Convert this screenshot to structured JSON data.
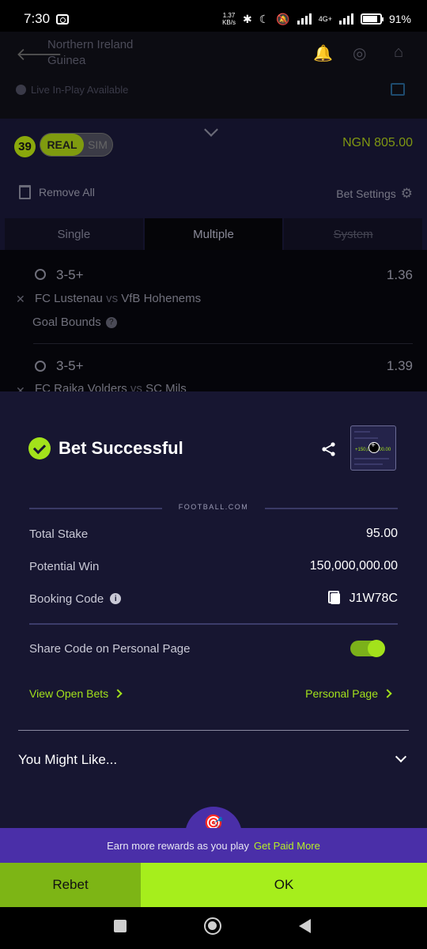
{
  "status_bar": {
    "time": "7:30",
    "net_speed": "1.37",
    "net_unit": "KB/s",
    "network": "4G+",
    "battery": "91%",
    "icons": [
      "camera-icon",
      "bluetooth-icon",
      "moon-icon",
      "silent-icon",
      "signal-icon",
      "battery-icon"
    ]
  },
  "match": {
    "team1": "Northern Ireland",
    "team2": "Guinea",
    "live_label": "Live In-Play Available"
  },
  "betslip": {
    "count": "39",
    "mode_real": "REAL",
    "mode_sim": "SIM",
    "balance": "NGN 805.00",
    "remove_all": "Remove All",
    "bet_settings": "Bet Settings",
    "tabs": [
      "Single",
      "Multiple",
      "System"
    ],
    "selections": [
      {
        "market": "3-5+",
        "odds": "1.36",
        "home": "FC Lustenau",
        "vs": "vs",
        "away": "VfB Hohenems",
        "bet_type": "Goal Bounds"
      },
      {
        "market": "3-5+",
        "odds": "1.39",
        "home": "FC Raika Volders",
        "vs": "vs",
        "away": "SC Mils"
      }
    ]
  },
  "modal": {
    "title": "Bet Successful",
    "brand": "FOOTBALL.COM",
    "thumb_amount": "+150,000,000.00",
    "total_stake_label": "Total Stake",
    "total_stake_value": "95.00",
    "potential_win_label": "Potential Win",
    "potential_win_value": "150,000,000.00",
    "booking_code_label": "Booking Code",
    "booking_code_value": "J1W78C",
    "share_code_label": "Share Code on Personal Page",
    "share_code_enabled": true,
    "view_open_bets": "View Open Bets",
    "personal_page": "Personal Page",
    "you_might_like": "You Might Like..."
  },
  "promo": {
    "text": "Earn more rewards as you play",
    "link": "Get Paid More"
  },
  "actions": {
    "rebet": "Rebet",
    "ok": "OK"
  },
  "colors": {
    "accent": "#a3e21b",
    "modal_bg": "#171631",
    "promo_bg": "#4a2fa8",
    "rebet_bg": "#7db515",
    "ok_bg": "#a6ee1c"
  }
}
